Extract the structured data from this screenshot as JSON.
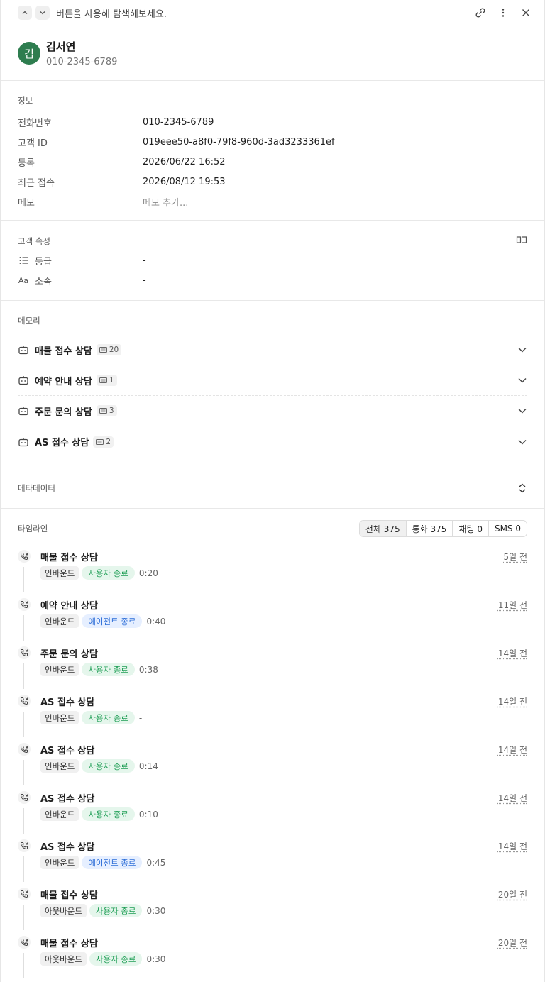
{
  "topbar": {
    "hint": "버튼을 사용해 탐색해보세요."
  },
  "profile": {
    "avatar_initial": "김",
    "name": "김서연",
    "phone": "010-2345-6789"
  },
  "info": {
    "title": "정보",
    "rows": [
      {
        "label": "전화번호",
        "value": "010-2345-6789"
      },
      {
        "label": "고객 ID",
        "value": "019eee50-a8f0-79f8-960d-3ad3233361ef"
      },
      {
        "label": "등록",
        "value": "2026/06/22 16:52"
      },
      {
        "label": "최근 접속",
        "value": "2026/08/12 19:53"
      },
      {
        "label": "메모",
        "value": "메모 추가..."
      }
    ]
  },
  "attributes": {
    "title": "고객 속성",
    "rows": [
      {
        "icon": "list-icon",
        "label": "등급",
        "value": "-"
      },
      {
        "icon": "text-aa-icon",
        "label": "소속",
        "value": "-"
      }
    ]
  },
  "memory": {
    "title": "메모리",
    "items": [
      {
        "name": "매물 접수 상담",
        "count": "20"
      },
      {
        "name": "예약 안내 상담",
        "count": "1"
      },
      {
        "name": "주문 문의 상담",
        "count": "3"
      },
      {
        "name": "AS 접수 상담",
        "count": "2"
      }
    ]
  },
  "metadata": {
    "title": "메타데이터"
  },
  "timeline": {
    "title": "타임라인",
    "filters": [
      "전체 375",
      "통화 375",
      "채팅 0",
      "SMS 0"
    ],
    "items": [
      {
        "title": "매물 접수 상담",
        "direction": "인바운드",
        "status": "사용자 종료",
        "status_type": "green",
        "duration": "0:20",
        "time": "5일 전"
      },
      {
        "title": "예약 안내 상담",
        "direction": "인바운드",
        "status": "에이전트 종료",
        "status_type": "blue",
        "duration": "0:40",
        "time": "11일 전"
      },
      {
        "title": "주문 문의 상담",
        "direction": "인바운드",
        "status": "사용자 종료",
        "status_type": "green",
        "duration": "0:38",
        "time": "14일 전"
      },
      {
        "title": "AS 접수 상담",
        "direction": "인바운드",
        "status": "사용자 종료",
        "status_type": "green",
        "duration": "-",
        "time": "14일 전"
      },
      {
        "title": "AS 접수 상담",
        "direction": "인바운드",
        "status": "사용자 종료",
        "status_type": "green",
        "duration": "0:14",
        "time": "14일 전"
      },
      {
        "title": "AS 접수 상담",
        "direction": "인바운드",
        "status": "사용자 종료",
        "status_type": "green",
        "duration": "0:10",
        "time": "14일 전"
      },
      {
        "title": "AS 접수 상담",
        "direction": "인바운드",
        "status": "에이전트 종료",
        "status_type": "blue",
        "duration": "0:45",
        "time": "14일 전"
      },
      {
        "title": "매물 접수 상담",
        "direction": "아웃바운드",
        "status": "사용자 종료",
        "status_type": "green",
        "duration": "0:30",
        "time": "20일 전"
      },
      {
        "title": "매물 접수 상담",
        "direction": "아웃바운드",
        "status": "사용자 종료",
        "status_type": "green",
        "duration": "0:30",
        "time": "20일 전"
      }
    ]
  }
}
